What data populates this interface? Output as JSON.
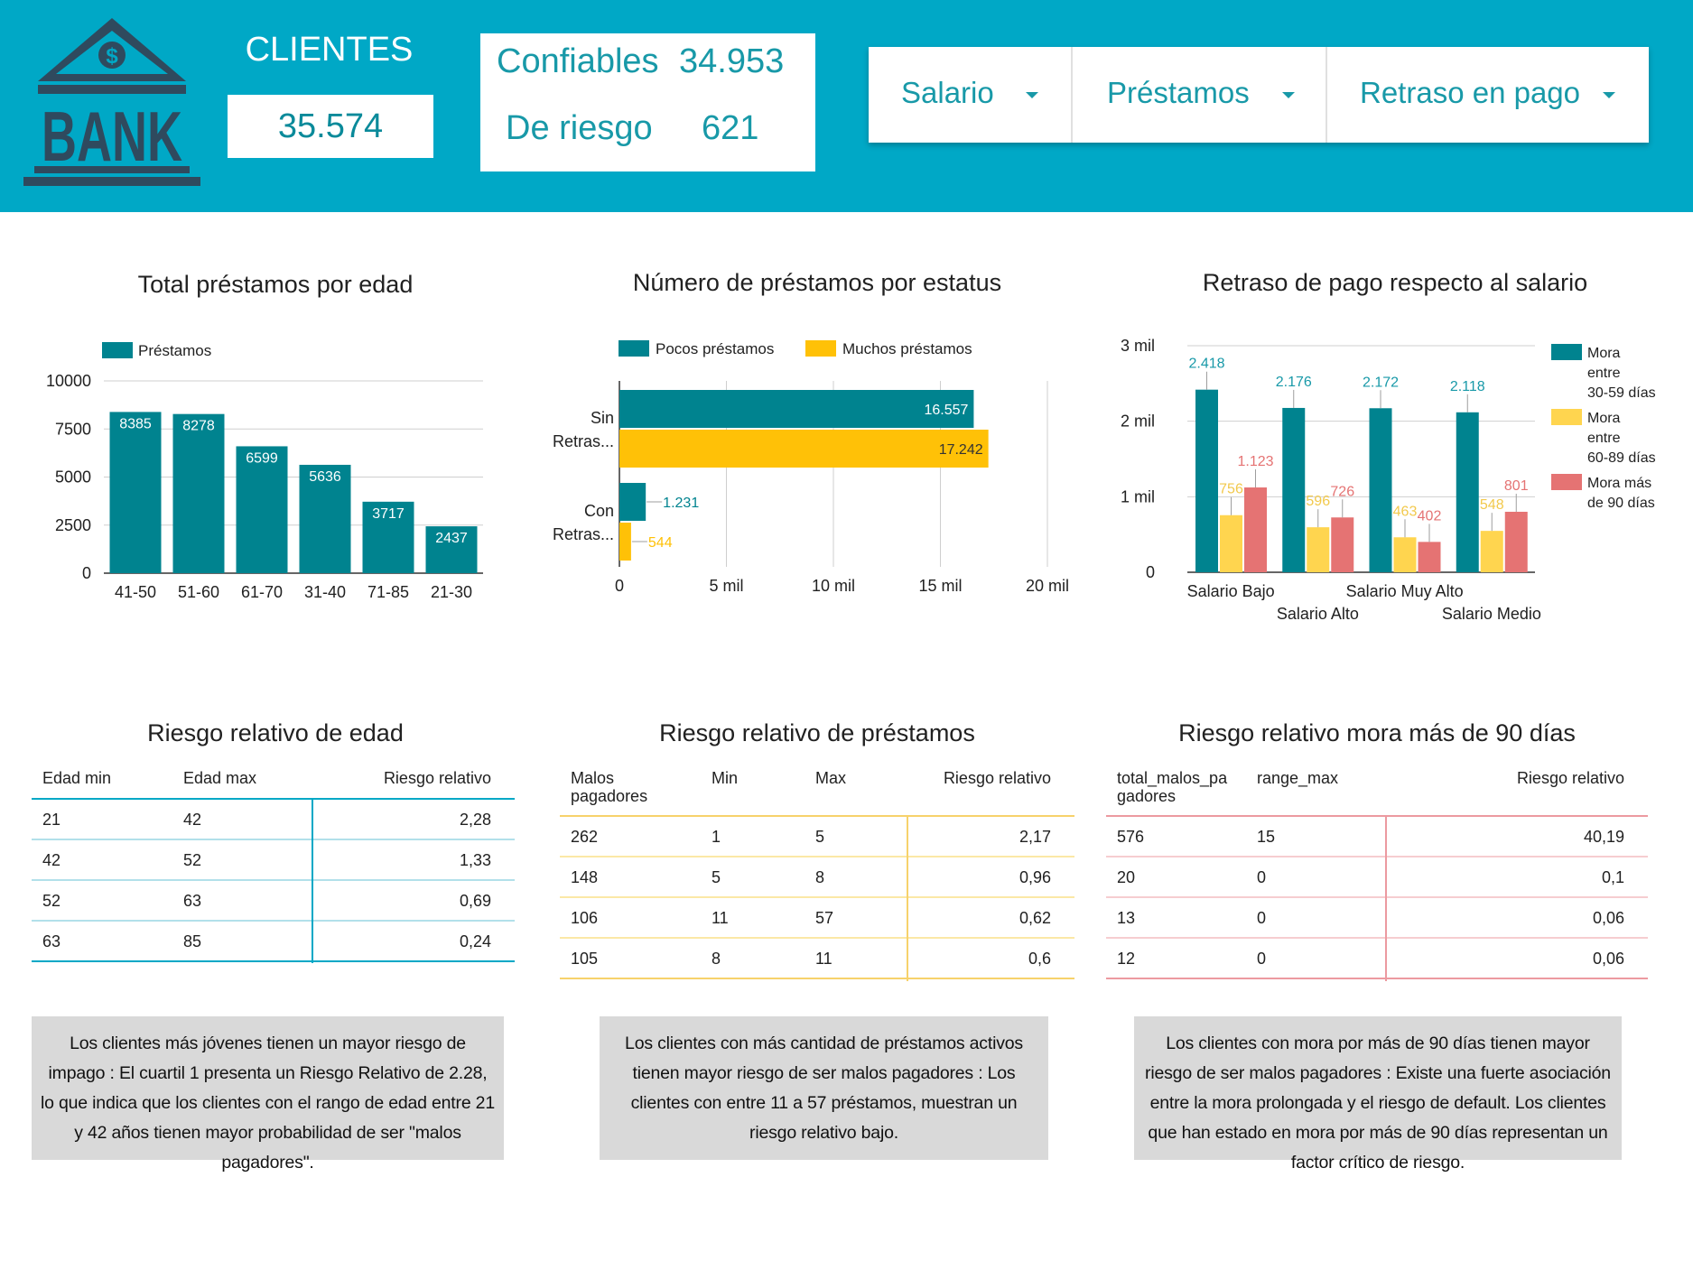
{
  "header": {
    "logo_text": "BANK",
    "clientes_label": "CLIENTES",
    "clientes_value": "35.574",
    "confiables_label": "Confiables",
    "confiables_value": "34.953",
    "riesgo_label": "De riesgo",
    "riesgo_value": "621",
    "filters": [
      "Salario",
      "Préstamos",
      "Retraso en pago"
    ]
  },
  "chart_data": [
    {
      "type": "bar",
      "title": "Total préstamos por edad",
      "categories": [
        "41-50",
        "51-60",
        "61-70",
        "31-40",
        "71-85",
        "21-30"
      ],
      "series": [
        {
          "name": "Préstamos",
          "values": [
            8385,
            8278,
            6599,
            5636,
            3717,
            2437
          ],
          "color": "#00838f"
        }
      ],
      "yticks": [
        "10000",
        "7500",
        "5000",
        "2500",
        "0"
      ],
      "ylim": [
        0,
        10000
      ],
      "legend": "top-left",
      "grid": true
    },
    {
      "type": "bar",
      "orientation": "horizontal",
      "title": "Número de préstamos por estatus",
      "categories": [
        "Sin Retras...",
        "Con Retras..."
      ],
      "series": [
        {
          "name": "Pocos préstamos",
          "values": [
            16557,
            1231
          ],
          "labels": [
            "16.557",
            "1.231"
          ],
          "color": "#00838f"
        },
        {
          "name": "Muchos préstamos",
          "values": [
            17242,
            544
          ],
          "labels": [
            "17.242",
            "544"
          ],
          "color": "#ffc107"
        }
      ],
      "xticks": [
        "0",
        "5 mil",
        "10 mil",
        "15 mil",
        "20 mil"
      ],
      "xlim": [
        0,
        20000
      ],
      "legend": "top",
      "grid": true
    },
    {
      "type": "bar",
      "title": "Retraso de pago respecto al salario",
      "categories": [
        "Salario Bajo",
        "Salario Alto",
        "Salario Muy Alto",
        "Salario Medio"
      ],
      "series": [
        {
          "name": "Mora entre 30-59 días",
          "legend_lines": [
            "Mora",
            "entre",
            "30-59 días"
          ],
          "values": [
            2418,
            2176,
            2172,
            2118
          ],
          "labels": [
            "2.418",
            "2.176",
            "2.172",
            "2.118"
          ],
          "color": "#00838f"
        },
        {
          "name": "Mora entre 60-89 días",
          "legend_lines": [
            "Mora",
            "entre",
            "60-89 días"
          ],
          "values": [
            756,
            596,
            463,
            548
          ],
          "labels": [
            "756",
            "596",
            "463",
            "548"
          ],
          "color": "#ffd54f"
        },
        {
          "name": "Mora más de 90 días",
          "legend_lines": [
            "Mora más",
            "de 90 días"
          ],
          "values": [
            1123,
            726,
            402,
            801
          ],
          "labels": [
            "1.123",
            "726",
            "402",
            "801"
          ],
          "color": "#e57373"
        }
      ],
      "yticks": [
        "3 mil",
        "2 mil",
        "1 mil",
        "0"
      ],
      "ylim": [
        0,
        3000
      ],
      "legend": "right",
      "grid": true
    }
  ],
  "tables": [
    {
      "title": "Riesgo relativo de edad",
      "headers": [
        "Edad min",
        "Edad max",
        "Riesgo relativo"
      ],
      "rows": [
        [
          "21",
          "42",
          "2,28"
        ],
        [
          "42",
          "52",
          "1,33"
        ],
        [
          "52",
          "63",
          "0,69"
        ],
        [
          "63",
          "85",
          "0,24"
        ]
      ]
    },
    {
      "title": "Riesgo relativo de préstamos",
      "headers": [
        "Malos pagadores",
        "Min",
        "Max",
        "Riesgo relativo"
      ],
      "header_lines": [
        [
          "Malos",
          "pagadores"
        ],
        [
          "Min"
        ],
        [
          "Max"
        ],
        [
          "Riesgo relativo"
        ]
      ],
      "rows": [
        [
          "262",
          "1",
          "5",
          "2,17"
        ],
        [
          "148",
          "5",
          "8",
          "0,96"
        ],
        [
          "106",
          "11",
          "57",
          "0,62"
        ],
        [
          "105",
          "8",
          "11",
          "0,6"
        ]
      ]
    },
    {
      "title": "Riesgo relativo mora más de 90 días",
      "headers": [
        "total_malos_pagadores",
        "range_max",
        "Riesgo relativo"
      ],
      "header_lines": [
        [
          "total_malos_pa",
          "gadores"
        ],
        [
          "range_max"
        ],
        [
          "Riesgo relativo"
        ]
      ],
      "rows": [
        [
          "576",
          "15",
          "40,19"
        ],
        [
          "20",
          "0",
          "0,1"
        ],
        [
          "13",
          "0",
          "0,06"
        ],
        [
          "12",
          "0",
          "0,06"
        ]
      ]
    }
  ],
  "notes": [
    "Los clientes más jóvenes tienen un mayor riesgo de impago : El cuartil 1 presenta un Riesgo Relativo de 2.28, lo que indica que los clientes con el rango de edad entre 21 y 42 años tienen mayor probabilidad de ser \"malos pagadores\".",
    "Los clientes con más cantidad de préstamos activos tienen mayor riesgo de ser malos pagadores : Los clientes con entre 11 a 57 préstamos, muestran un riesgo relativo bajo.",
    "Los clientes con mora por más de 90 días tienen mayor riesgo de ser malos pagadores : Existe una fuerte asociación entre la mora prolongada y el riesgo de default. Los clientes que han estado en mora por más de 90 días representan un factor crítico de riesgo."
  ],
  "colors": {
    "header_bg": "#00a8c6",
    "teal": "#00838f",
    "yellow": "#ffc107",
    "red": "#e57373",
    "accent_text": "#1899a8"
  }
}
